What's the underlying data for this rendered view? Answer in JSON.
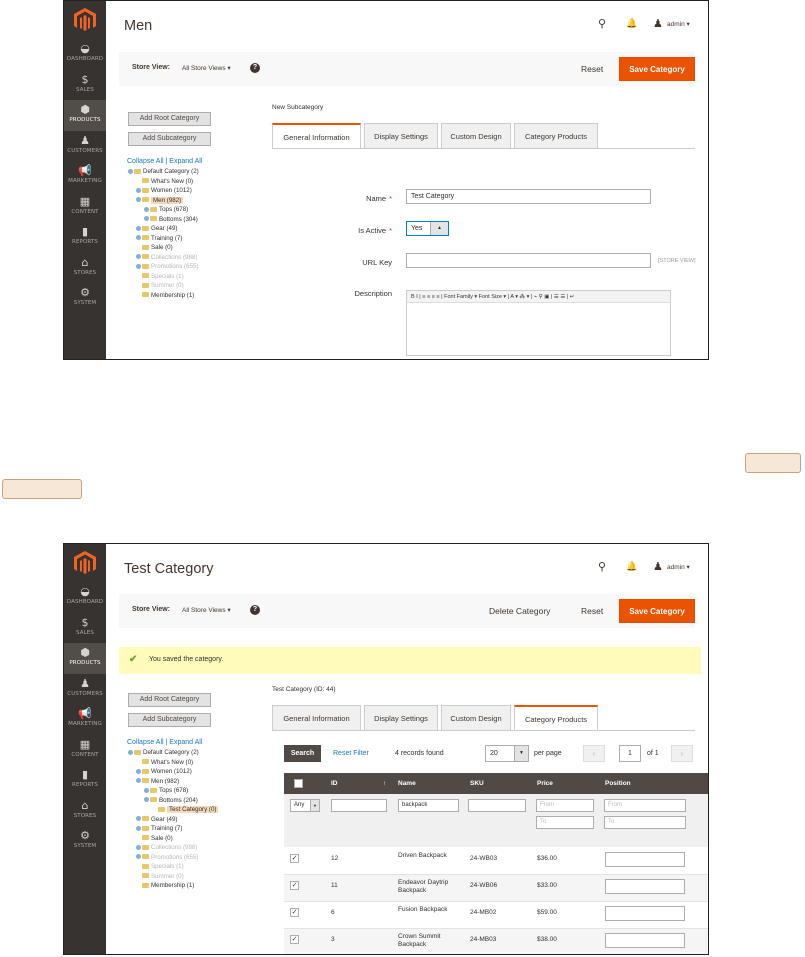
{
  "nav": [
    {
      "label": "DASHBOARD",
      "icon": "dashboard-icon",
      "glyph": "◒"
    },
    {
      "label": "SALES",
      "icon": "dollar-icon",
      "glyph": "$"
    },
    {
      "label": "PRODUCTS",
      "icon": "cube-icon",
      "glyph": "⬢"
    },
    {
      "label": "CUSTOMERS",
      "icon": "person-icon",
      "glyph": "♟"
    },
    {
      "label": "MARKETING",
      "icon": "megaphone-icon",
      "glyph": "📢"
    },
    {
      "label": "CONTENT",
      "icon": "content-icon",
      "glyph": "▦"
    },
    {
      "label": "REPORTS",
      "icon": "bar-chart-icon",
      "glyph": "▮"
    },
    {
      "label": "STORES",
      "icon": "store-icon",
      "glyph": "⌂"
    },
    {
      "label": "SYSTEM",
      "icon": "gear-icon",
      "glyph": "⚙"
    }
  ],
  "header": {
    "admin_label": "admin ▾"
  },
  "storeview": {
    "label": "Store View:",
    "value": "All Store Views ▾",
    "help": "?"
  },
  "buttons": {
    "reset": "Reset",
    "save": "Save Category",
    "delete": "Delete Category",
    "add_root": "Add Root Category",
    "add_sub": "Add Subcategory"
  },
  "tree_links": "Collapse All | Expand All",
  "tabs": [
    "General Information",
    "Display Settings",
    "Custom Design",
    "Category Products"
  ],
  "screen1": {
    "title": "Men",
    "subheading": "New Subcategory",
    "tree": [
      {
        "text": "Default Category (2)",
        "indent": 0,
        "ex": true
      },
      {
        "text": "What's New (0)",
        "indent": 1,
        "ex": false
      },
      {
        "text": "Women (1012)",
        "indent": 1,
        "ex": true
      },
      {
        "text": "Men (982)",
        "indent": 1,
        "ex": true,
        "sel": true
      },
      {
        "text": "Tops (678)",
        "indent": 2,
        "ex": true
      },
      {
        "text": "Bottoms (304)",
        "indent": 2,
        "ex": true
      },
      {
        "text": "Gear (49)",
        "indent": 1,
        "ex": true
      },
      {
        "text": "Training (7)",
        "indent": 1,
        "ex": true
      },
      {
        "text": "Sale (0)",
        "indent": 1,
        "ex": false
      },
      {
        "text": "Collections (988)",
        "indent": 1,
        "ex": true,
        "faded": true
      },
      {
        "text": "Promotions (655)",
        "indent": 1,
        "ex": true,
        "faded": true
      },
      {
        "text": "Specials (1)",
        "indent": 1,
        "ex": false,
        "faded": true
      },
      {
        "text": "Summer (0)",
        "indent": 1,
        "ex": false,
        "faded": true
      },
      {
        "text": "Membership (1)",
        "indent": 1,
        "ex": false
      }
    ],
    "form": {
      "name_label": "Name",
      "name_value": "Test Category",
      "active_label": "Is Active",
      "active_value": "Yes",
      "urlkey_label": "URL Key",
      "urlkey_value": "",
      "scope": "[STORE VIEW]",
      "desc_label": "Description",
      "toolbar": "B  I  |  ≡ ≡ ≡ ≡  |  Font Family ▾  Font Size ▾  |  A ▾ ⁂ ▾  |  ⌁ ⚲ ▣  |  ☰ ☰  |  ↵"
    }
  },
  "screen2": {
    "title": "Test Category",
    "message": "You saved the category.",
    "subheading": "Test Category (ID: 44)",
    "tree": [
      {
        "text": "Default Category (2)",
        "indent": 0,
        "ex": true
      },
      {
        "text": "What's New (0)",
        "indent": 1,
        "ex": false
      },
      {
        "text": "Women (1012)",
        "indent": 1,
        "ex": true
      },
      {
        "text": "Men (982)",
        "indent": 1,
        "ex": true
      },
      {
        "text": "Tops (678)",
        "indent": 2,
        "ex": true
      },
      {
        "text": "Bottoms (204)",
        "indent": 2,
        "ex": true
      },
      {
        "text": "Test Category (0)",
        "indent": 3,
        "ex": false,
        "sel": true
      },
      {
        "text": "Gear (49)",
        "indent": 1,
        "ex": true
      },
      {
        "text": "Training (7)",
        "indent": 1,
        "ex": true
      },
      {
        "text": "Sale (0)",
        "indent": 1,
        "ex": false
      },
      {
        "text": "Collections (988)",
        "indent": 1,
        "ex": true,
        "faded": true
      },
      {
        "text": "Promotions (655)",
        "indent": 1,
        "ex": true,
        "faded": true
      },
      {
        "text": "Specials (1)",
        "indent": 1,
        "ex": false,
        "faded": true
      },
      {
        "text": "Summer (0)",
        "indent": 1,
        "ex": false,
        "faded": true
      },
      {
        "text": "Membership (1)",
        "indent": 1,
        "ex": false
      }
    ],
    "grid": {
      "search": "Search",
      "reset_filter": "Reset Filter",
      "records": "4 records found",
      "per_page_value": "20",
      "per_page_label": "per page",
      "page": "1",
      "of_pages": "of 1",
      "columns": [
        "ID",
        "↑",
        "Name",
        "SKU",
        "Price",
        "Position"
      ],
      "filter_any": "Any",
      "filter_name": "backpack",
      "from": "From",
      "to": "To",
      "rows": [
        {
          "id": "12",
          "name": "Driven Backpack",
          "sku": "24-WB03",
          "price": "$36.00"
        },
        {
          "id": "11",
          "name": "Endeavor Daytrip Backpack",
          "sku": "24-WB06",
          "price": "$33.00"
        },
        {
          "id": "6",
          "name": "Fusion Backpack",
          "sku": "24-MB02",
          "price": "$59.00"
        },
        {
          "id": "3",
          "name": "Crown Summit Backpack",
          "sku": "24-MB03",
          "price": "$38.00"
        }
      ]
    }
  }
}
